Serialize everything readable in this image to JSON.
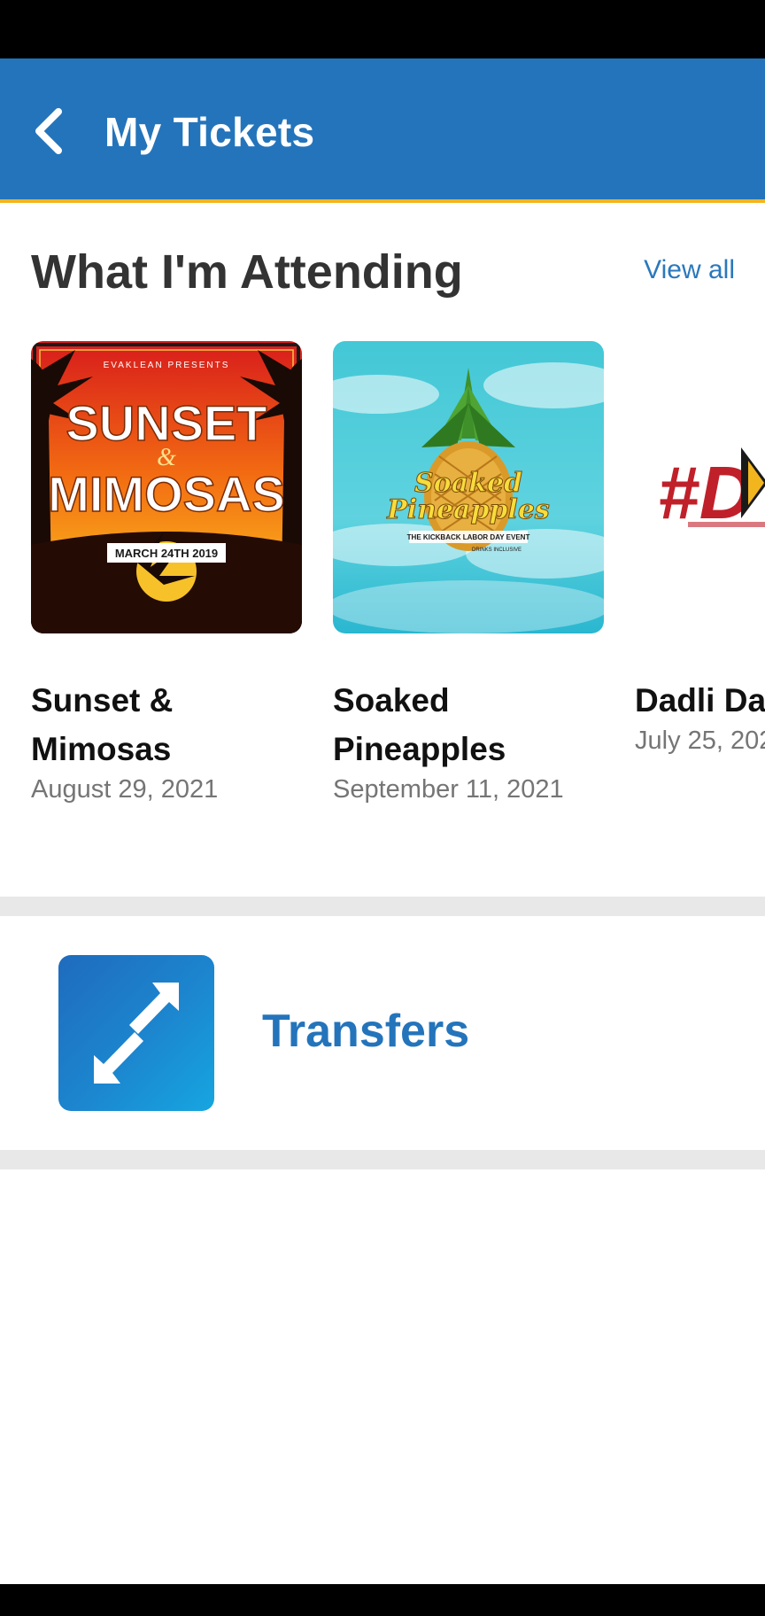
{
  "header": {
    "title": "My Tickets",
    "back_icon": "chevron-left-icon"
  },
  "attending": {
    "title": "What I'm Attending",
    "view_all_label": "View all",
    "events": [
      {
        "name": "Sunset & Mimosas",
        "date": "August 29, 2021",
        "art": {
          "presenter": "EVAKLEAN PRESENTS",
          "line1": "SUNSET",
          "amp": "&",
          "line2": "MIMOSAS",
          "date_banner": "MARCH 24TH 2019"
        }
      },
      {
        "name": "Soaked Pineapples",
        "date": "September 11, 2021",
        "art": {
          "line1": "Soaked",
          "line2": "Pineapples",
          "tagline": "THE KICKBACK LABOR DAY EVENT",
          "subtag": "DRINKS INCLUSIVE"
        }
      },
      {
        "name": "Dadli Da",
        "date": "July 25, 202",
        "art": {
          "text": "#D"
        }
      }
    ]
  },
  "transfers": {
    "label": "Transfers",
    "icon": "transfer-arrows-icon"
  },
  "colors": {
    "primary": "#2474bb",
    "accent_border": "#f2b51e",
    "link": "#2a78bd",
    "divider": "#e8e8e8"
  }
}
